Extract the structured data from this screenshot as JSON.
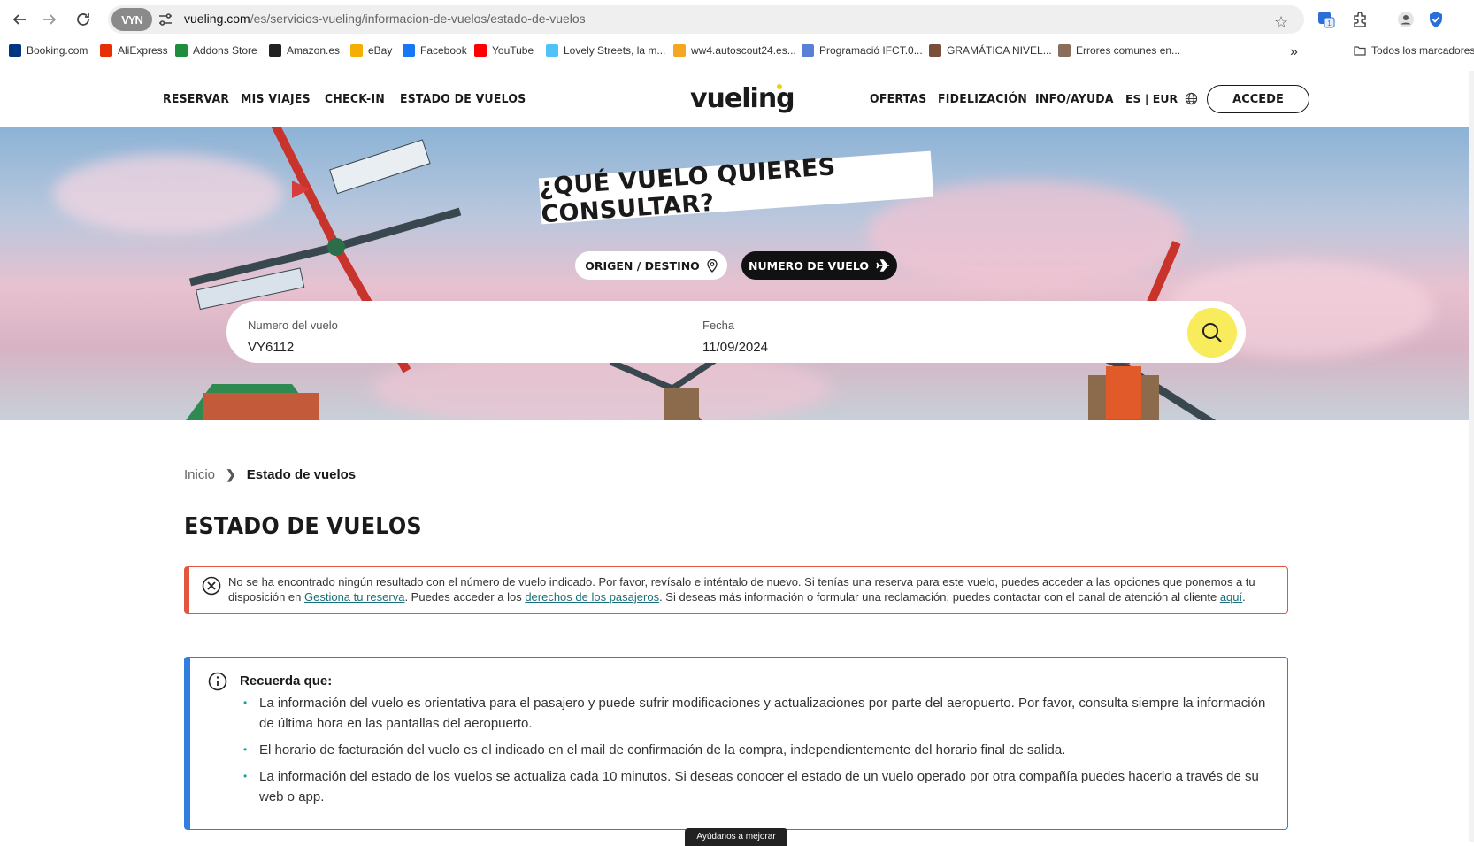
{
  "browser": {
    "site_badge": "VYN",
    "url_host": "vueling.com",
    "url_path": "/es/servicios-vueling/informacion-de-vuelos/estado-de-vuelos",
    "extension_badge": "1",
    "bookmarks": [
      {
        "label": "Booking.com",
        "color": "#003580"
      },
      {
        "label": "AliExpress",
        "color": "#e62e04"
      },
      {
        "label": "Addons Store",
        "color": "#1e8e3e"
      },
      {
        "label": "Amazon.es",
        "color": "#222222"
      },
      {
        "label": "eBay",
        "color": "#f5af02"
      },
      {
        "label": "Facebook",
        "color": "#1877f2"
      },
      {
        "label": "YouTube",
        "color": "#ff0000"
      },
      {
        "label": "Lovely Streets, la m...",
        "color": "#4fc3f7"
      },
      {
        "label": "ww4.autoscout24.es...",
        "color": "#f5a623"
      },
      {
        "label": "Programació IFCT.0...",
        "color": "#5b7fd6"
      },
      {
        "label": "GRAMÁTICA NIVEL...",
        "color": "#7a4f3a"
      },
      {
        "label": "Errores comunes en...",
        "color": "#8a6d5a"
      }
    ],
    "more_bookmarks": "»",
    "all_bookmarks": "Todos los marcadores"
  },
  "header": {
    "nav_left": [
      "RESERVAR",
      "MIS VIAJES",
      "CHECK-IN",
      "ESTADO DE VUELOS"
    ],
    "logo": "vueling",
    "nav_right": [
      "OFERTAS",
      "FIDELIZACIÓN",
      "INFO/AYUDA"
    ],
    "lang": "ES | EUR",
    "login": "ACCEDE"
  },
  "hero": {
    "title": "¿QUÉ VUELO QUIERES CONSULTAR?",
    "tab_route": "ORIGEN / DESTINO",
    "tab_flight": "NUMERO DE VUELO",
    "flight_label": "Numero del vuelo",
    "flight_value": "VY6112",
    "date_label": "Fecha",
    "date_value": "11/09/2024",
    "accent": "#f8ec5c"
  },
  "breadcrumb": {
    "home": "Inicio",
    "separator": "❯",
    "current": "Estado de vuelos"
  },
  "page_title": "ESTADO DE VUELOS",
  "error": {
    "text_1": "No se ha encontrado ningún resultado con el número de vuelo indicado. Por favor, revísalo e inténtalo de nuevo. Si tenías una reserva para este vuelo, puedes acceder a las opciones que ponemos a tu disposición en ",
    "link_1": "Gestiona tu reserva",
    "text_2": ". Puedes acceder a los ",
    "link_2": "derechos de los pasajeros",
    "text_3": ". Si deseas más información o formular una reclamación, puedes contactar con el canal de atención al cliente ",
    "link_3": "aquí",
    "text_4": ".",
    "color": "#e0563e"
  },
  "info": {
    "title": "Recuerda que:",
    "items": [
      "La información del vuelo es orientativa para el pasajero y puede sufrir modificaciones y actualizaciones por parte del aeropuerto. Por favor, consulta siempre la información de última hora en las pantallas del aeropuerto.",
      "El horario de facturación del vuelo es el indicado en el mail de confirmación de la compra, independientemente del horario final de salida.",
      "La información del estado de los vuelos se actualiza cada 10 minutos. Si deseas conocer el estado de un vuelo operado por otra compañía puedes hacerlo a través de su web o app."
    ],
    "color": "#2f7ee0"
  },
  "feedback": "Ayúdanos a mejorar"
}
